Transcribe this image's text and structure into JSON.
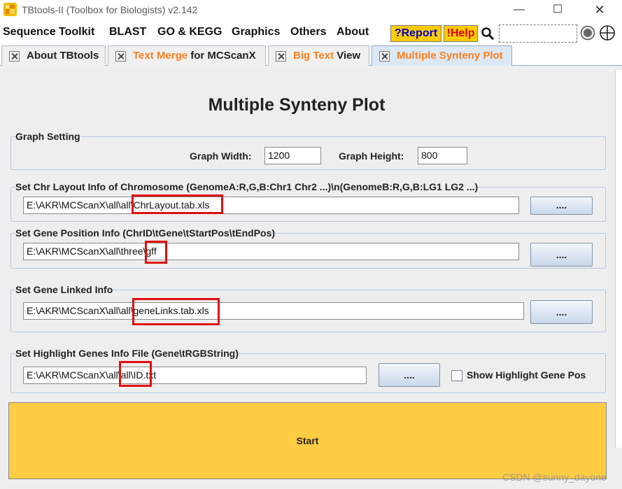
{
  "window": {
    "title": "TBtools-II (Toolbox for Biologists) v2.142",
    "minimize_glyph": "—",
    "maximize_glyph": "☐",
    "close_glyph": "✕"
  },
  "menu": {
    "items": [
      "Sequence Toolkit",
      "BLAST",
      "GO & KEGG",
      "Graphics",
      "Others",
      "About"
    ],
    "report_label": "?Report",
    "help_label": "!Help",
    "search_value": ""
  },
  "tabs": [
    {
      "label_a": "About TBtools",
      "label_b": ""
    },
    {
      "label_a": "Text Merge",
      "label_b": " for MCScanX"
    },
    {
      "label_a": "Big Text",
      "label_b": " View"
    },
    {
      "label_a": "Multiple Synteny Plot",
      "label_b": ""
    }
  ],
  "page": {
    "title": "Multiple Synteny Plot"
  },
  "graph_setting": {
    "legend": "Graph Setting",
    "width_label": "Graph Width:",
    "width_value": "1200",
    "height_label": "Graph Height:",
    "height_value": "800"
  },
  "chr_layout": {
    "legend": "Set Chr Layout Info of Chromosome (GenomeA:R,G,B:Chr1 Chr2 ...)\\n(GenomeB:R,G,B:LG1 LG2 ...)",
    "path": "E:\\AKR\\MCScanX\\all\\all\\ChrLayout.tab.xls",
    "browse_label": "...."
  },
  "gene_position": {
    "legend": "Set Gene Position Info (ChrID\\tGene\\tStartPos\\tEndPos)",
    "path": "E:\\AKR\\MCScanX\\all\\three\\gff",
    "browse_label": "...."
  },
  "gene_linked": {
    "legend": "Set Gene Linked Info",
    "path": "E:\\AKR\\MCScanX\\all\\all\\geneLinks.tab.xls",
    "browse_label": "...."
  },
  "highlight": {
    "legend": "Set Highlight Genes Info File (Gene\\tRGBString)",
    "path": "E:\\AKR\\MCScanX\\all\\all\\ID.txt",
    "browse_label": "....",
    "checkbox_label": "Show Highlight Gene Pos",
    "checkbox_checked": false
  },
  "start": {
    "label": "Start"
  },
  "watermark": "CSDN @sunny_dayone",
  "colors": {
    "accent_orange": "#ff7f1e",
    "button_yellow": "#ffcc00",
    "start_yellow": "#ffcc44",
    "highlight_red": "#e01010"
  }
}
